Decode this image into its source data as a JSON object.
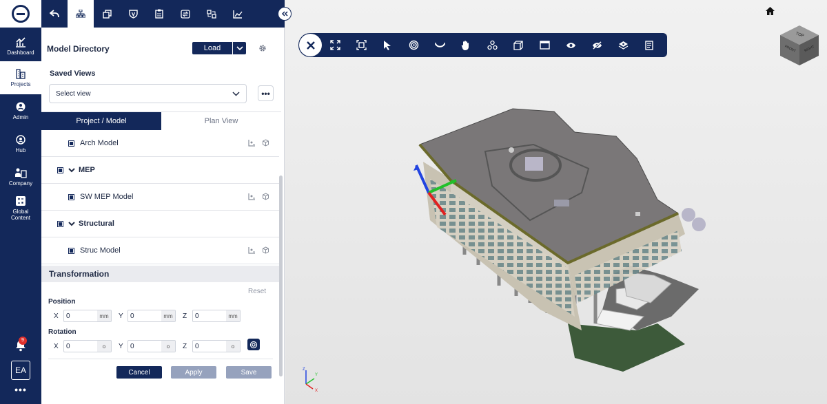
{
  "nav": {
    "items": [
      {
        "label": "Dashboard"
      },
      {
        "label": "Projects"
      },
      {
        "label": "Admin"
      },
      {
        "label": "Hub"
      },
      {
        "label": "Company"
      },
      {
        "label": "Global Content"
      }
    ],
    "notification_count": "9",
    "user_initials": "EA",
    "more": "•••"
  },
  "panel": {
    "title": "Model Directory",
    "load_label": "Load",
    "saved_views_label": "Saved Views",
    "select_view_value": "Select view",
    "more_dots": "•••",
    "tabs": [
      {
        "label": "Project / Model",
        "active": true
      },
      {
        "label": "Plan View",
        "active": false
      }
    ],
    "tree": [
      {
        "label": "Arch Model",
        "type": "model"
      },
      {
        "label": "MEP",
        "type": "group"
      },
      {
        "label": "SW MEP Model",
        "type": "model"
      },
      {
        "label": "Structural",
        "type": "group"
      },
      {
        "label": "Struc Model",
        "type": "model"
      }
    ]
  },
  "transformation": {
    "title": "Transformation",
    "reset_label": "Reset",
    "position_label": "Position",
    "rotation_label": "Rotation",
    "position": {
      "x": "0",
      "y": "0",
      "z": "0",
      "unit": "mm"
    },
    "rotation": {
      "x": "0",
      "y": "0",
      "z": "0",
      "unit": "o"
    },
    "axis_labels": {
      "x": "X",
      "y": "Y",
      "z": "Z"
    },
    "cancel_label": "Cancel",
    "apply_label": "Apply",
    "save_label": "Save"
  },
  "viewer": {
    "cube_labels": {
      "top": "TOP",
      "front": "FRONT",
      "right": "RIGHT"
    },
    "axis_labels": {
      "x": "X",
      "y": "Y",
      "z": "Z"
    }
  },
  "colors": {
    "primary": "#13285a",
    "disabled_button": "#96a2bd",
    "notification": "#e0312d",
    "axis_x": "#e02020",
    "axis_y": "#22c02a",
    "axis_z": "#2244e0"
  }
}
